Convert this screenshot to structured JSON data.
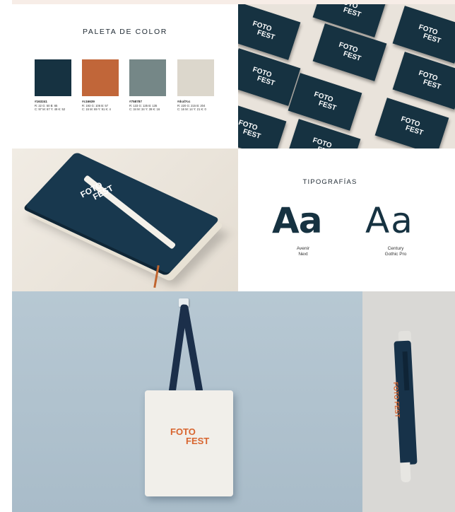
{
  "palette": {
    "title": "PALETA DE COLOR",
    "swatches": [
      {
        "color": "#163241",
        "hex": "#163241",
        "rgb": "R: 22 G: 50 B: 65",
        "cmyk": "C: 97 M: 67 Y: 49 K: 52"
      },
      {
        "color": "#c16639",
        "hex": "#c16639",
        "rgb": "R: 193 G: 106 B: 57",
        "cmyk": "C: 15 M: 69 Y: 91 K: 4"
      },
      {
        "color": "#758787",
        "hex": "#758787",
        "rgb": "R: 133 G: 135 B: 135",
        "cmyk": "C: 34 M: 34 Y: 39 K: 16"
      },
      {
        "color": "#dcd7cc",
        "hex": "#dcd7cc",
        "rgb": "R: 220 G: 215 B: 204",
        "cmyk": "C: 16 M: 14 Y: 21 K: 0"
      }
    ]
  },
  "brand": {
    "line1": "FOTO",
    "line2": "FEST"
  },
  "typography": {
    "title": "TIPOGRAFÍAS",
    "sample_bold": "Aa",
    "sample_light": "Aa",
    "font1_line1": "Avenir",
    "font1_line2": "Next",
    "font2_line1": "Century",
    "font2_line2": "Gothic Pro"
  },
  "pen_logo": "FOTO FEST",
  "colors": {
    "navy": "#163241",
    "orange": "#d8652f",
    "cream": "#f1efea"
  }
}
